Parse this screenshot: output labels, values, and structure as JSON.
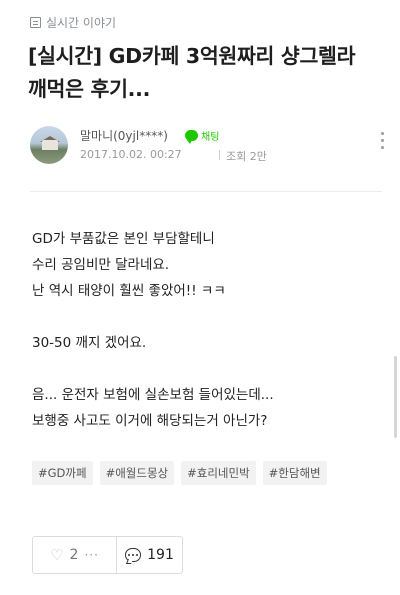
{
  "board": {
    "label": "실시간 이야기"
  },
  "post": {
    "title": "[실시간] GD카페 3억원짜리 샹그렐라 깨먹은 후기...",
    "author": {
      "nickname": "말마니(0yjl****)",
      "chat_label": "채팅"
    },
    "date": "2017.10.02. 00:27",
    "views": "조회 2만",
    "paragraphs": [
      [
        "GD가 부품값은 본인 부담할테니",
        "수리 공임비만 달라네요.",
        "난 역시 태양이 훨씬 좋았어!! ㅋㅋ"
      ],
      [
        "30-50 깨지 겠어요."
      ],
      [
        "음... 운전자 보험에 실손보험 들어있는데...",
        "보행중 사고도 이거에 해당되는거 아닌가?"
      ]
    ],
    "tags": [
      "#GD까페",
      "#애월드몽상",
      "#효리네민박",
      "#한담해변"
    ]
  },
  "actions": {
    "like_count": "2",
    "more": "···",
    "comment_count": "191"
  },
  "colors": {
    "accent_green": "#1ec800",
    "muted": "#9a9a9a"
  },
  "icons": {
    "board": "list-icon",
    "chat": "chat-bubble-icon",
    "more": "vertical-dots-icon",
    "like": "heart-icon",
    "comment": "comment-icon"
  }
}
